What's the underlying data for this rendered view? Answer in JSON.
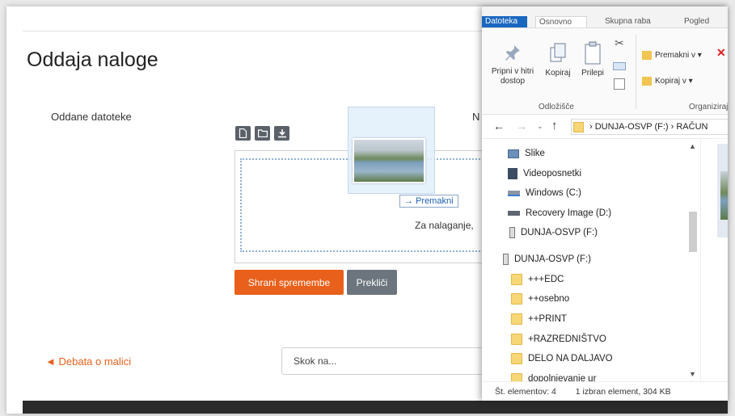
{
  "moodle": {
    "page_title": "Oddaja naloge",
    "submitted_files_label": "Oddane datoteke",
    "side_label_fragment": "N",
    "upload_hint": "Za nalaganje,",
    "drag_tooltip": "Premakni",
    "save_button": "Shrani spremembe",
    "cancel_button": "Prekliči",
    "previous_link": "Debata o malici",
    "jump_select": "Skok na..."
  },
  "explorer": {
    "tabs": [
      "Datoteka",
      "Osnovno",
      "Skupna raba",
      "Pogled"
    ],
    "ribbon": {
      "pin_label": "Pripni v hitri dostop",
      "copy_label": "Kopiraj",
      "paste_label": "Prilepi",
      "move_to_label": "Premakni v",
      "copy_to_label": "Kopiraj v",
      "clipboard_group": "Odložišče",
      "organize_group": "Organiziraj"
    },
    "address": {
      "path": "DUNJA-OSVP (F:)  ›  RAČUN"
    },
    "tree_items": [
      {
        "label": "Slike",
        "icon": "pictures-icon"
      },
      {
        "label": "Videoposnetki",
        "icon": "videos-icon"
      },
      {
        "label": "Windows (C:)",
        "icon": "drive-icon"
      },
      {
        "label": "Recovery Image (D:)",
        "icon": "drive-icon"
      },
      {
        "label": "DUNJA-OSVP (F:)",
        "icon": "usb-drive-icon"
      },
      {
        "label": "DUNJA-OSVP (F:)",
        "icon": "usb-drive-icon"
      },
      {
        "label": "+++EDC",
        "icon": "folder-icon"
      },
      {
        "label": "++osebno",
        "icon": "folder-icon"
      },
      {
        "label": "++PRINT",
        "icon": "folder-icon"
      },
      {
        "label": "+RAZREDNIŠTVO",
        "icon": "folder-icon"
      },
      {
        "label": "DELO NA DALJAVO",
        "icon": "folder-icon"
      },
      {
        "label": "dopolnjevanje ur",
        "icon": "folder-icon"
      }
    ],
    "status": {
      "items_count": "Št. elementov: 4",
      "selection": "1 izbran element, 304 KB"
    }
  }
}
